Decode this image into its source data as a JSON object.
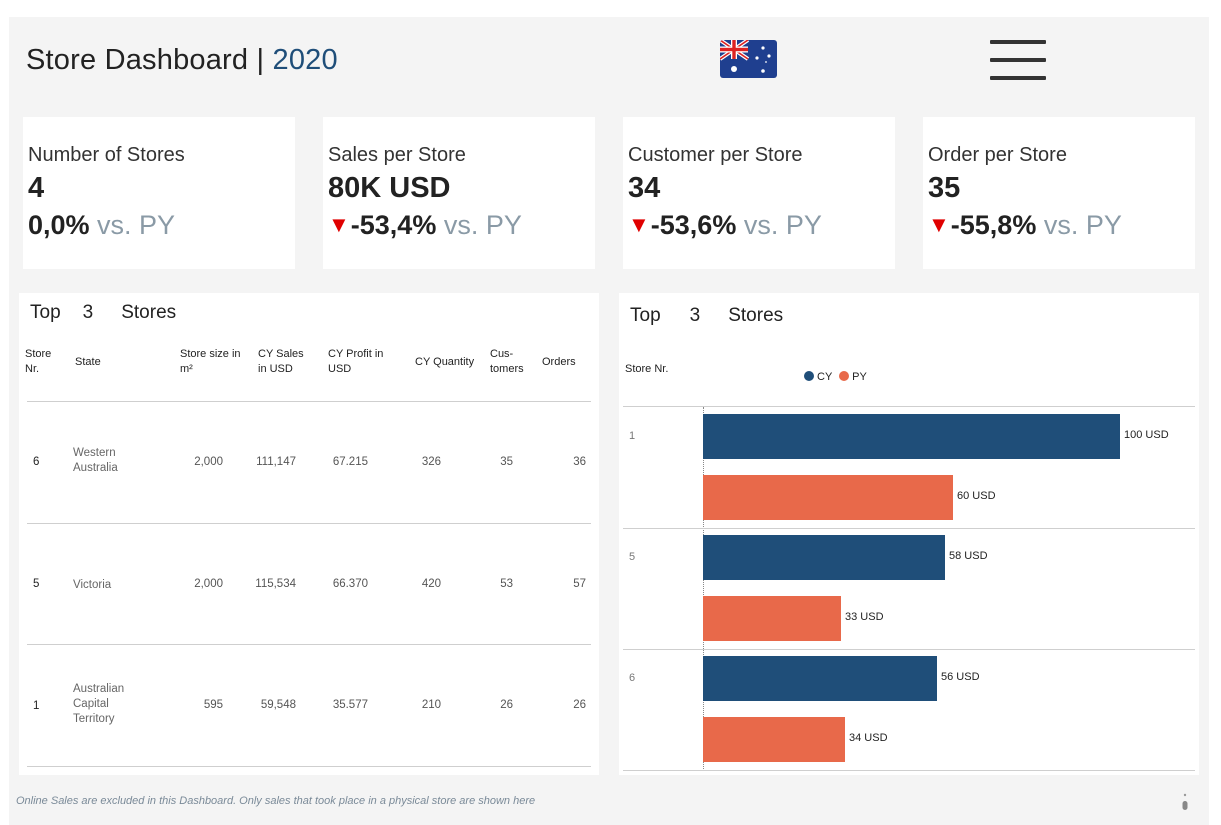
{
  "header": {
    "title": "Store Dashboard | ",
    "year": "2020",
    "flag_icon": "australia-flag-icon",
    "menu_icon": "hamburger-menu-icon"
  },
  "kpis": [
    {
      "label": "Number of Stores",
      "value": "4",
      "change": "0,0%",
      "down": false,
      "suffix": " vs. PY"
    },
    {
      "label": "Sales per Store",
      "value": "80K USD",
      "change": "-53,4%",
      "down": true,
      "suffix": " vs. PY"
    },
    {
      "label": "Customer per Store",
      "value": "34",
      "change": "-53,6%",
      "down": true,
      "suffix": " vs. PY"
    },
    {
      "label": "Order per Store",
      "value": "35",
      "change": "-55,8%",
      "down": true,
      "suffix": " vs. PY"
    }
  ],
  "colors": {
    "cy": "#1f4e79",
    "py": "#e8694a",
    "down": "#e00000"
  },
  "table": {
    "head_top": "Top",
    "head_n": "3",
    "head_stores": "Stores",
    "columns": [
      "Store Nr.",
      "State",
      "Store size in m²",
      "CY Sales in USD",
      "CY Profit in USD",
      "CY Quantity",
      "Cus-tomers",
      "Orders"
    ],
    "rows": [
      {
        "store": "6",
        "state": "Western Australia",
        "size": "2,000",
        "sales": "111,147",
        "profit": "67.215",
        "qty": "326",
        "customers": "35",
        "orders": "36"
      },
      {
        "store": "5",
        "state": "Victoria",
        "size": "2,000",
        "sales": "115,534",
        "profit": "66.370",
        "qty": "420",
        "customers": "53",
        "orders": "57"
      },
      {
        "store": "1",
        "state": "Australian Capital Territory",
        "size": "595",
        "sales": "59,548",
        "profit": "35.577",
        "qty": "210",
        "customers": "26",
        "orders": "26"
      }
    ]
  },
  "chart_head": {
    "top": "Top",
    "n": "3",
    "stores": "Stores",
    "axis_label": "Store Nr."
  },
  "chart_data": {
    "type": "bar",
    "orientation": "horizontal",
    "categories": [
      "1",
      "5",
      "6"
    ],
    "series": [
      {
        "name": "CY",
        "values": [
          100,
          58,
          56
        ],
        "labels": [
          "100 USD",
          "58 USD",
          "56 USD"
        ]
      },
      {
        "name": "PY",
        "values": [
          60,
          33,
          34
        ],
        "labels": [
          "60 USD",
          "33 USD",
          "34 USD"
        ]
      }
    ],
    "ylabel": "Store Nr.",
    "legend": "top",
    "xlim": [
      0,
      100
    ]
  },
  "footnote": "Online Sales are excluded in this Dashboard. Only sales that took place in a physical store are shown here"
}
